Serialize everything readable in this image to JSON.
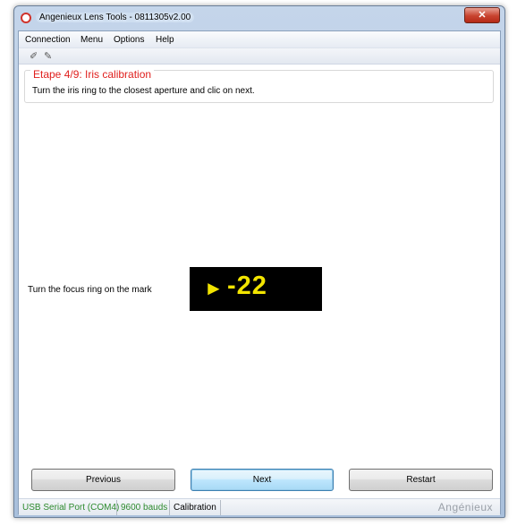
{
  "window": {
    "title": "Angenieux Lens Tools - 0811305v2.00",
    "close_glyph": "✕"
  },
  "menu": [
    "Connection",
    "Menu",
    "Options",
    "Help"
  ],
  "toolbar": {
    "icons": [
      "connect-plug-icon",
      "disconnect-plug-icon"
    ],
    "glyphs": [
      "✐",
      "✎"
    ]
  },
  "step": {
    "title": "Etape 4/9: Iris calibration",
    "instruction": "Turn the iris ring to the closest aperture and clic on next."
  },
  "focus": {
    "label": "Turn the focus ring on the mark",
    "arrow": "►",
    "value": "-22",
    "display_color": "#f2e400"
  },
  "buttons": {
    "previous": "Previous",
    "next": "Next",
    "restart": "Restart"
  },
  "status": {
    "port": "USB Serial Port (COM4)",
    "baud": "9600 bauds",
    "mode": "Calibration",
    "port_color": "#2e8b2e",
    "brand": "Angénieux"
  },
  "colors": {
    "accent_red": "#e0201e"
  }
}
